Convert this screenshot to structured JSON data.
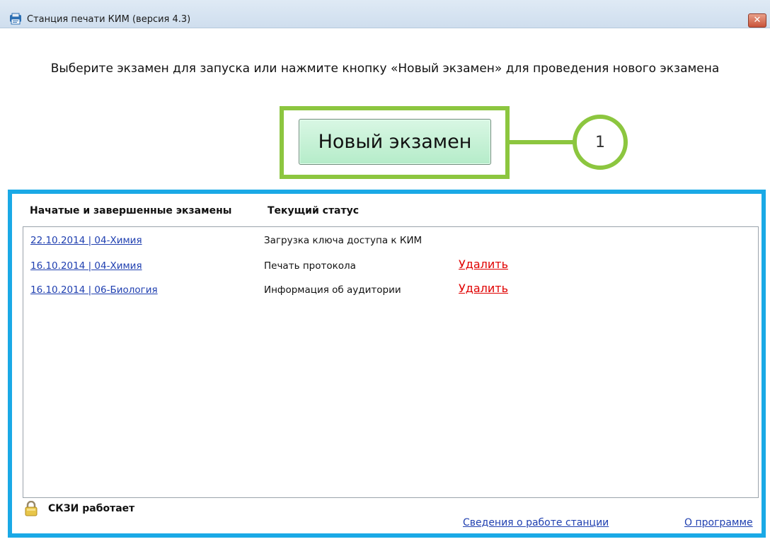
{
  "window": {
    "title": "Станция печати КИМ (версия 4.3)",
    "close_label": "✕",
    "icon": "app-printer-icon"
  },
  "instruction": "Выберите экзамен для запуска или нажмите кнопку «Новый экзамен» для проведения нового экзамена",
  "new_exam_button": "Новый экзамен",
  "callout_number": "1",
  "columns": {
    "exams": "Начатые и завершенные экзамены",
    "status": "Текущий статус"
  },
  "exams": [
    {
      "name": "22.10.2014 | 04-Химия",
      "status": "Загрузка ключа доступа к КИМ",
      "delete": ""
    },
    {
      "name": "16.10.2014 | 04-Химия",
      "status": "Печать протокола",
      "delete": "Удалить"
    },
    {
      "name": "16.10.2014 | 06-Биология",
      "status": "Информация об аудитории",
      "delete": "Удалить"
    }
  ],
  "footer": {
    "skzi_status": "СКЗИ работает",
    "station_info_link": "Сведения о работе станции",
    "about_link": "О программе",
    "lock_icon": "lock-icon"
  },
  "colors": {
    "callout_green": "#8cc63f",
    "panel_blue": "#1aa9e6",
    "link_blue": "#1f3fb0",
    "delete_red": "#e00000"
  }
}
